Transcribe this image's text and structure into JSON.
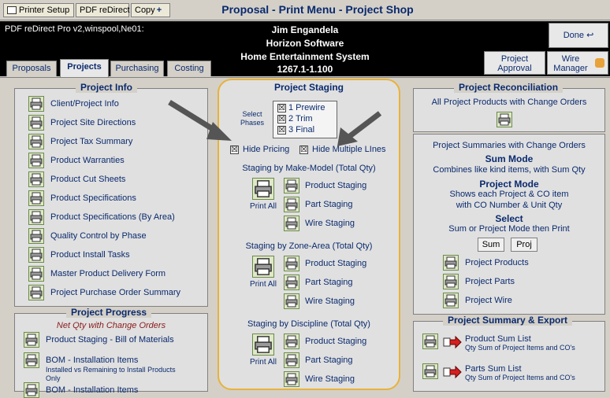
{
  "toolbar": {
    "printer_setup": "Printer Setup",
    "pdf_redirect": "PDF reDirect",
    "copy": "Copy"
  },
  "window": {
    "title": "Proposal - Print Menu - Project Shop"
  },
  "header": {
    "left_info": "PDF reDirect Pro v2,winspool,Ne01:",
    "name": "Jim Engandela",
    "company": "Horizon Software",
    "project": "Home Entertainment System",
    "version": "1267.1-1.100",
    "done": "Done",
    "project_approval": "Project Approval",
    "wire_manager": "Wire Manager"
  },
  "tabs": [
    "Proposals",
    "Projects",
    "Purchasing",
    "Costing"
  ],
  "project_info": {
    "title": "Project Info",
    "items": [
      "Client/Project Info",
      "Project Site Directions",
      "Project Tax Summary",
      "Product Warranties",
      "Product Cut Sheets",
      "Product Specifications",
      "Product Specifications (By Area)",
      "Quality Control by Phase",
      "Product Install Tasks",
      "Master Product Delivery Form",
      "Project Purchase Order Summary"
    ]
  },
  "project_progress": {
    "title": "Project Progress",
    "subtitle": "Net Qty with Change Orders",
    "items": [
      {
        "label": "Product Staging - Bill of Materials",
        "sub": ""
      },
      {
        "label": "BOM - Installation Items",
        "sub": "Installed vs Remaining to Install Products Only"
      },
      {
        "label": "BOM - Installation Items",
        "sub": ""
      }
    ]
  },
  "staging": {
    "title": "Project Staging",
    "select_phases": "Select Phases",
    "phases": [
      "1 Prewire",
      "2 Trim",
      "3 Final"
    ],
    "hide_pricing": "Hide Pricing",
    "hide_multiple_lines": "Hide Multiple LInes",
    "print_all": "Print All",
    "groups": [
      {
        "title": "Staging by Make-Model (Total Qty)",
        "items": [
          "Product Staging",
          "Part Staging",
          "Wire Staging"
        ]
      },
      {
        "title": "Staging by Zone-Area (Total Qty)",
        "items": [
          "Product Staging",
          "Part Staging",
          "Wire Staging"
        ]
      },
      {
        "title": "Staging by Discipline (Total Qty)",
        "items": [
          "Product Staging",
          "Part Staging",
          "Wire Staging"
        ]
      }
    ]
  },
  "reconciliation": {
    "title": "Project Reconciliation",
    "all_products": "All Project Products with Change Orders",
    "summaries": "Project Summaries with Change Orders",
    "sum_mode": "Sum Mode",
    "sum_mode_desc": "Combines like kind items, with Sum Qty",
    "project_mode": "Project Mode",
    "project_mode_desc1": "Shows each Project & CO item",
    "project_mode_desc2": "with CO Number & Unit Qty",
    "select": "Select",
    "select_desc": "Sum or Project Mode then Print",
    "sum_btn": "Sum",
    "proj_btn": "Proj",
    "items": [
      "Project Products",
      "Project Parts",
      "Project Wire"
    ]
  },
  "summary_export": {
    "title": "Project Summary & Export",
    "items": [
      {
        "label": "Product Sum List",
        "sub": "Qty Sum of Project Items and CO's"
      },
      {
        "label": "Parts Sum List",
        "sub": "Qty Sum of Project Items and CO's"
      }
    ]
  }
}
